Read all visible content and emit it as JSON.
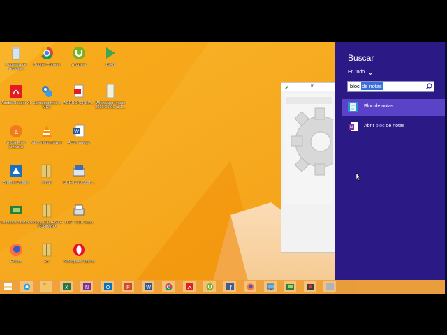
{
  "desktop": {
    "icons": [
      {
        "label": "Papelera de reciclaje",
        "icon": "recycle-bin-icon"
      },
      {
        "label": "Google Chrome",
        "icon": "chrome-icon"
      },
      {
        "label": "µTorrent",
        "icon": "utorrent-icon"
      },
      {
        "label": "Bsk8",
        "icon": "green-arrow-app-icon"
      },
      {
        "label": "Adobe Reader XI",
        "icon": "adobe-reader-icon"
      },
      {
        "label": "Samsung Kies 3 MKV",
        "icon": "samsung-kies-icon"
      },
      {
        "label": "AGPROPEPSIA...",
        "icon": "pdf-file-icon"
      },
      {
        "label": "WhatsApp Image 2019-05-06 at 1...",
        "icon": "image-file-icon"
      },
      {
        "label": "Avast Free Antivirus",
        "icon": "avast-icon"
      },
      {
        "label": "VLC media player",
        "icon": "vlc-icon"
      },
      {
        "label": "Acta entrega",
        "icon": "word-doc-icon"
      },
      {
        "label": "Brother Utilities",
        "icon": "brother-utilities-icon"
      },
      {
        "label": "email",
        "icon": "folder-icon"
      },
      {
        "label": "DCP-T310 Scan...",
        "icon": "scanner-icon"
      },
      {
        "label": "Camtasia Studio 8",
        "icon": "camtasia-icon"
      },
      {
        "label": "envios CALIENTE SOHIMBO",
        "icon": "folder-zip-icon"
      },
      {
        "label": "DCP-T310 Scan",
        "icon": "printer-icon"
      },
      {
        "label": "Firefox",
        "icon": "firefox-icon"
      },
      {
        "label": "28",
        "icon": "folder-zip-icon"
      },
      {
        "label": "Navegador Opera",
        "icon": "opera-icon"
      }
    ]
  },
  "background_window": {
    "title": "In"
  },
  "search_charm": {
    "title": "Buscar",
    "scope": "En todo",
    "query_prefix": "bloc ",
    "query_selected": "de notas",
    "results": [
      {
        "label": "Bloc de notas",
        "icon": "notepad-icon",
        "selected": true
      },
      {
        "prefix": "Abrir ",
        "highlight": "bloc",
        "suffix": " de notas",
        "icon": "onenote-icon",
        "selected": false
      }
    ]
  },
  "taskbar": {
    "items": [
      {
        "icon": "windows-start-icon"
      },
      {
        "icon": "internet-explorer-icon"
      },
      {
        "icon": "file-explorer-icon"
      },
      {
        "icon": "excel-icon"
      },
      {
        "icon": "onenote-icon"
      },
      {
        "icon": "outlook-icon"
      },
      {
        "icon": "powerpoint-icon"
      },
      {
        "icon": "word-icon"
      },
      {
        "icon": "chrome-icon"
      },
      {
        "icon": "adobe-reader-icon"
      },
      {
        "icon": "utorrent-icon"
      },
      {
        "icon": "facebook-icon"
      },
      {
        "icon": "firefox-icon"
      },
      {
        "icon": "remote-desktop-icon"
      },
      {
        "icon": "camtasia-icon"
      },
      {
        "icon": "camtasia-recorder-icon"
      },
      {
        "icon": "app-icon"
      }
    ]
  },
  "colors": {
    "wallpaper": "#f7a81c",
    "charm_background": "#2b1a85",
    "selected_result": "#5a43c7",
    "search_selection": "#3b6fd9"
  }
}
